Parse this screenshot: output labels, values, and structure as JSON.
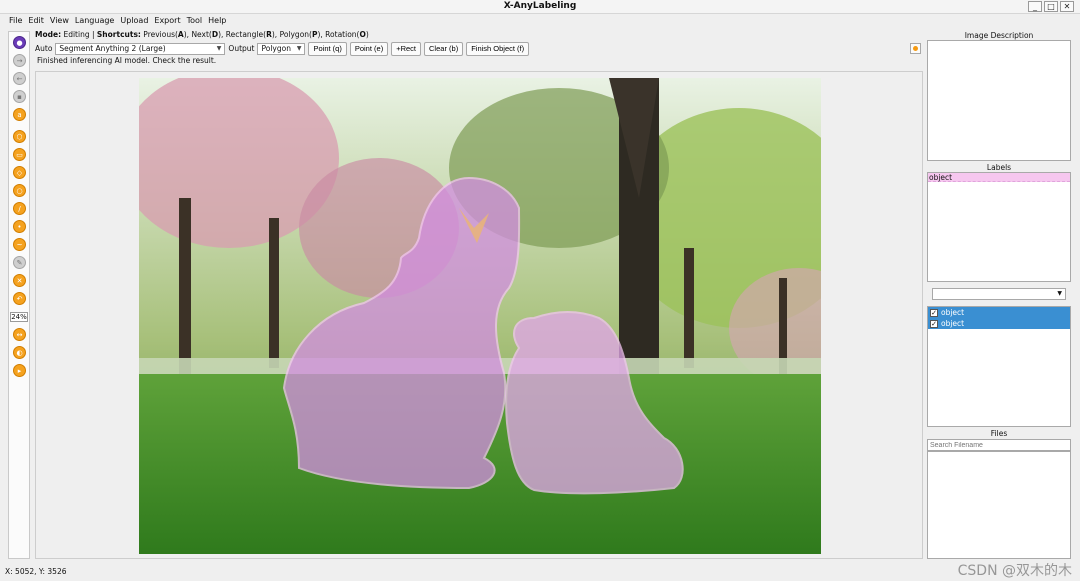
{
  "window": {
    "title": "X-AnyLabeling",
    "controls": [
      "_",
      "□",
      "✕"
    ]
  },
  "menu": [
    "File",
    "Edit",
    "View",
    "Language",
    "Upload",
    "Export",
    "Tool",
    "Help"
  ],
  "mode": {
    "label": "Mode:",
    "value": "Editing",
    "separator": " | ",
    "shortcuts_label": "Shortcuts:",
    "shortcuts": [
      {
        "name": "Previous(",
        "key": "A",
        "end": "), "
      },
      {
        "name": "Next(",
        "key": "D",
        "end": "), "
      },
      {
        "name": "Rectangle(",
        "key": "R",
        "end": "), "
      },
      {
        "name": "Polygon(",
        "key": "P",
        "end": "), "
      },
      {
        "name": "Rotation(",
        "key": "O",
        "end": ")"
      }
    ]
  },
  "controls": {
    "auto_label": "Auto",
    "model": "Segment Anything 2 (Large)",
    "output_label": "Output",
    "output": "Polygon",
    "buttons": [
      "Point (q)",
      "Point (e)",
      "+Rect",
      "Clear (b)",
      "Finish Object (f)"
    ]
  },
  "status_message": "Finished inferencing AI model. Check the result.",
  "toolbar": {
    "zoom": "24%",
    "icons": [
      "open-icon",
      "next-icon",
      "prev-icon",
      "ai-icon",
      "polygon-icon",
      "rectangle-icon",
      "rotation-icon",
      "circle-icon",
      "line-icon",
      "point-icon",
      "linestrip-icon",
      "edit-icon",
      "delete-icon",
      "undo-icon",
      "fit-width-icon",
      "brightness-icon",
      "run-icon"
    ]
  },
  "right_panel": {
    "description_title": "Image Description",
    "labels_title": "Labels",
    "labels": [
      "object"
    ],
    "shapes": [
      {
        "label": "object",
        "checked": true
      },
      {
        "label": "object",
        "checked": true
      }
    ],
    "files_title": "Files",
    "search_placeholder": "Search Filename"
  },
  "status_bar": {
    "coordinates": "X: 5052, Y: 3526",
    "watermark": "CSDN @双木的木"
  },
  "colors": {
    "accent": "#f5a21f",
    "selection": "#3a8fd2",
    "mask": "#d28ee0",
    "label_bg": "#f6c7ef"
  }
}
